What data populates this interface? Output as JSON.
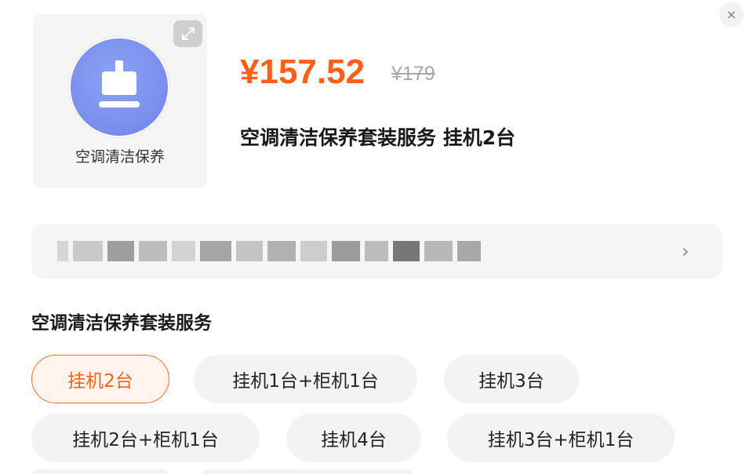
{
  "close": {
    "icon": "close-icon",
    "glyph": "×"
  },
  "product": {
    "image_caption": "空调清洁保养",
    "image_icon": "cleaning-brush-icon",
    "expand_icon": "expand-icon",
    "price": "¥157.52",
    "original_price": "¥179",
    "title": "空调清洁保养套装服务 挂机2台"
  },
  "address": {
    "chevron_icon": "chevron-right-icon",
    "chevron_glyph": "›",
    "blurred": true
  },
  "spec": {
    "section_title": "空调清洁保养套装服务",
    "options": [
      {
        "label": "挂机2台",
        "selected": true
      },
      {
        "label": "挂机1台+柜机1台",
        "selected": false
      },
      {
        "label": "挂机3台",
        "selected": false
      },
      {
        "label": "挂机2台+柜机1台",
        "selected": false
      },
      {
        "label": "挂机4台",
        "selected": false
      },
      {
        "label": "挂机3台+柜机1台",
        "selected": false
      }
    ]
  },
  "colors": {
    "accent": "#ff5f16",
    "selected_border": "#ff6a2a",
    "icon_circle": "#7c90ee"
  }
}
